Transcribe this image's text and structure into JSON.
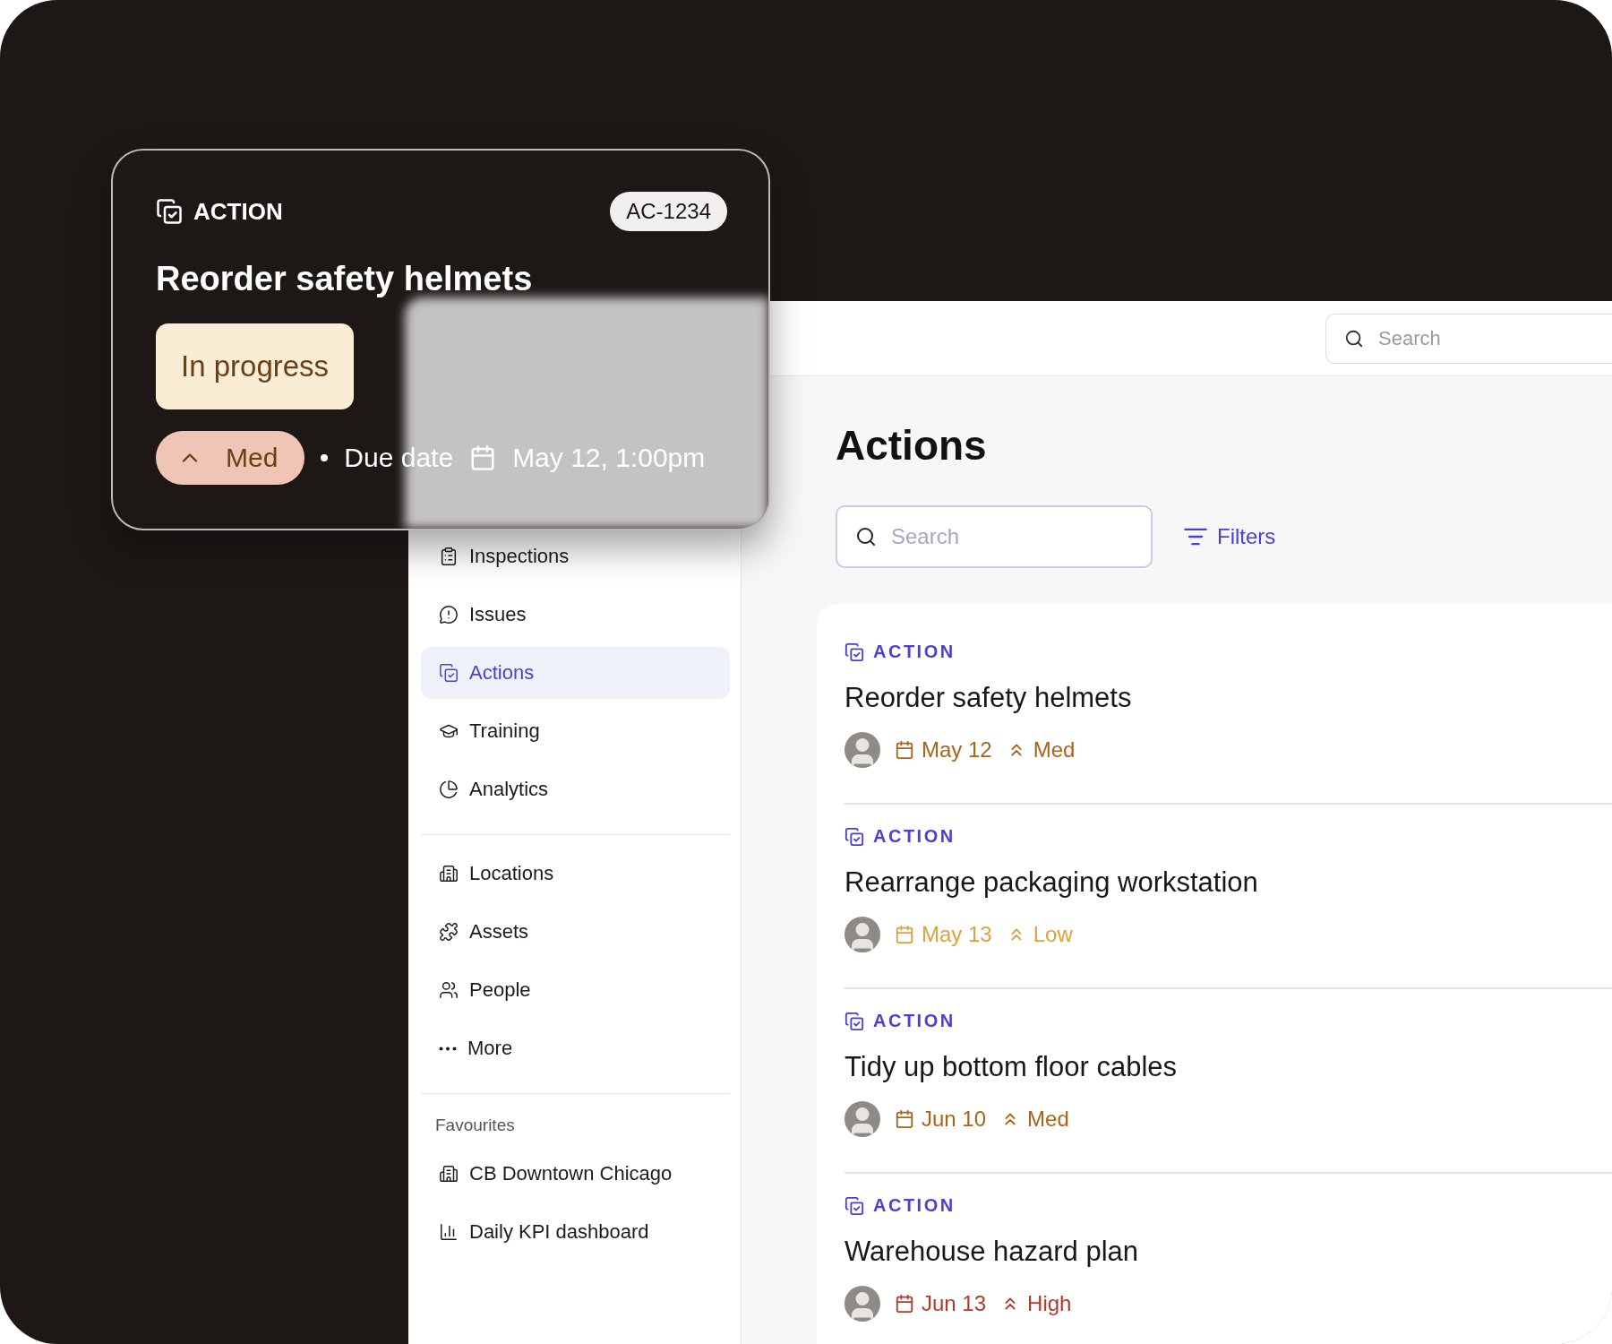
{
  "action_card": {
    "type_label": "ACTION",
    "id": "AC-1234",
    "title": "Reorder safety helmets",
    "status": "In progress",
    "priority": "Med",
    "due_label": "Due date",
    "due": "May 12, 1:00pm"
  },
  "top_bar": {
    "search": {
      "placeholder": "Search"
    }
  },
  "sidebar": {
    "sections": [
      {
        "items": [
          {
            "kind": "inspections",
            "label": "Inspections",
            "selected": false
          },
          {
            "kind": "issues",
            "label": "Issues",
            "selected": false
          },
          {
            "kind": "actions",
            "label": "Actions",
            "selected": true
          },
          {
            "kind": "training",
            "label": "Training",
            "selected": false
          },
          {
            "kind": "analytics",
            "label": "Analytics",
            "selected": false
          }
        ]
      },
      {
        "items": [
          {
            "kind": "locations",
            "label": "Locations",
            "selected": false
          },
          {
            "kind": "assets",
            "label": "Assets",
            "selected": false
          },
          {
            "kind": "people",
            "label": "People",
            "selected": false
          },
          {
            "kind": "more",
            "label": "More",
            "selected": false
          }
        ]
      },
      {
        "heading": "Favourites",
        "items": [
          {
            "kind": "locations",
            "label": "CB Downtown Chicago",
            "selected": false
          },
          {
            "kind": "dashboard",
            "label": "Daily KPI dashboard",
            "selected": false
          }
        ]
      }
    ]
  },
  "page": {
    "title": "Actions",
    "search": {
      "placeholder": "Search"
    },
    "filters": "Filters"
  },
  "actions": [
    {
      "type_label": "ACTION",
      "title": "Reorder safety helmets",
      "date": "May 12",
      "priority": "Med",
      "color": "#a8641a"
    },
    {
      "type_label": "ACTION",
      "title": "Rearrange packaging workstation",
      "date": "May 13",
      "priority": "Low",
      "color": "#e0a040"
    },
    {
      "type_label": "ACTION",
      "title": "Tidy up bottom floor cables",
      "date": "Jun 10",
      "priority": "Med",
      "color": "#a8641a"
    },
    {
      "type_label": "ACTION",
      "title": "Warehouse hazard plan",
      "date": "Jun 13",
      "priority": "High",
      "color": "#b33a2a"
    }
  ]
}
